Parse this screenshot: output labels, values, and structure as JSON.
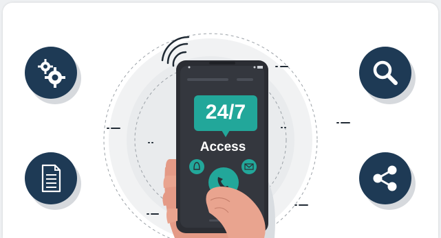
{
  "hero": {
    "bubble_text": "24/7",
    "caption": "Access"
  },
  "buttons": {
    "settings": {
      "icon": "gears-icon"
    },
    "search": {
      "icon": "magnifier-icon"
    },
    "document": {
      "icon": "document-icon"
    },
    "share": {
      "icon": "share-icon"
    }
  },
  "colors": {
    "navy": "#1e3a55",
    "teal": "#22a79a",
    "phone_body": "#2b2d33",
    "skin": "#e9a48f",
    "ring_fill": "#f1f2f3"
  }
}
